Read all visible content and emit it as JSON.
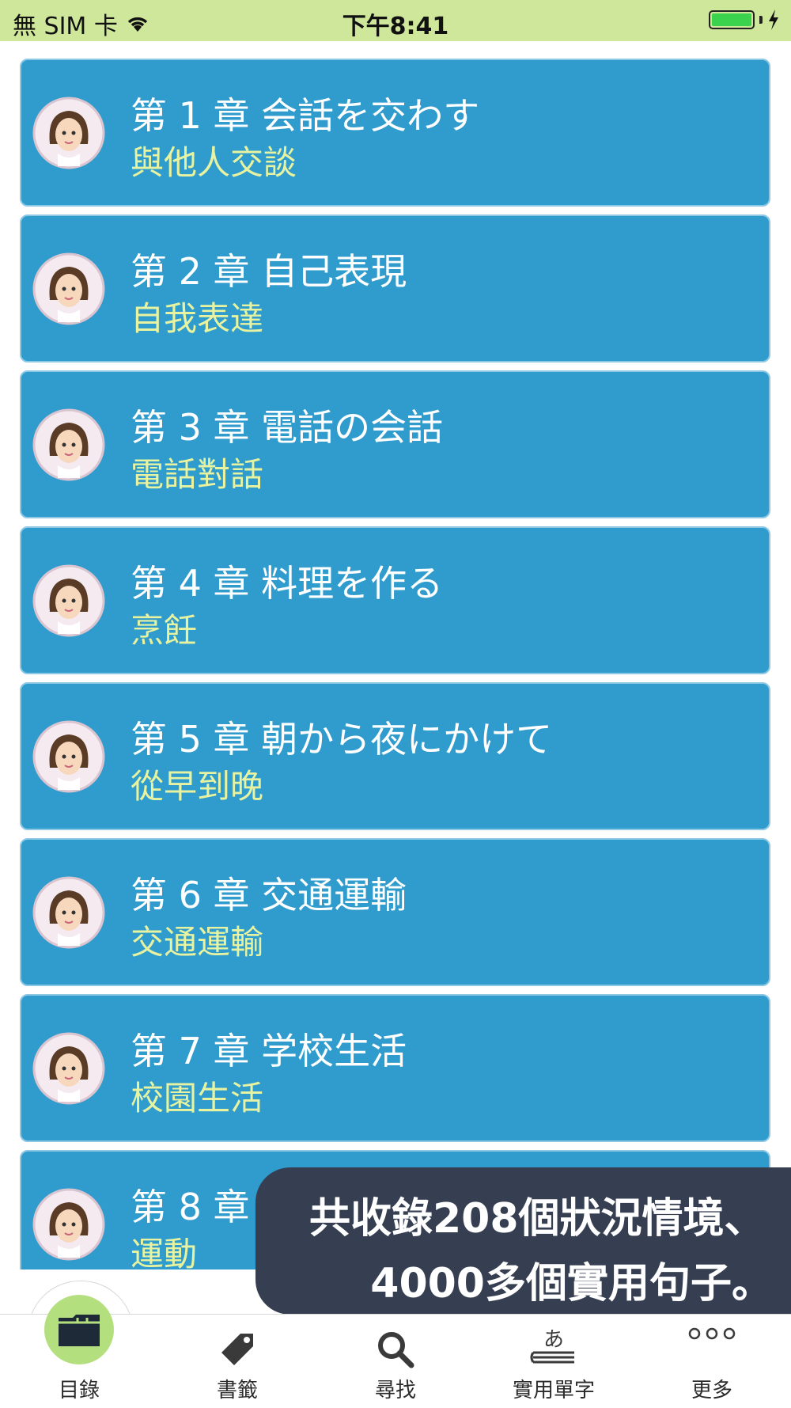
{
  "status_bar": {
    "carrier": "無 SIM 卡",
    "time": "下午8:41",
    "battery_level_percent": 100,
    "battery_color": "#3bd24e"
  },
  "chapters": [
    {
      "title": "第 1 章 会話を交わす",
      "subtitle": "與他人交談"
    },
    {
      "title": "第 2 章 自己表現",
      "subtitle": "自我表達"
    },
    {
      "title": "第 3 章 電話の会話",
      "subtitle": "電話對話"
    },
    {
      "title": "第 4 章 料理を作る",
      "subtitle": "烹飪"
    },
    {
      "title": "第 5 章 朝から夜にかけて",
      "subtitle": "從早到晚"
    },
    {
      "title": "第 6 章 交通運輸",
      "subtitle": "交通運輸"
    },
    {
      "title": "第 7 章 学校生活",
      "subtitle": "校園生活"
    },
    {
      "title": "第 8 章",
      "subtitle": "運動"
    }
  ],
  "toast": {
    "line1": "共收錄208個狀況情境、",
    "line2": "4000多個實用句子。"
  },
  "tabs": [
    {
      "label": "目錄",
      "icon": "folder-icon",
      "active": true
    },
    {
      "label": "書籤",
      "icon": "tag-icon",
      "active": false
    },
    {
      "label": "尋找",
      "icon": "search-icon",
      "active": false
    },
    {
      "label": "實用單字",
      "icon": "book-kana-icon",
      "active": false
    },
    {
      "label": "更多",
      "icon": "more-dots-icon",
      "active": false
    }
  ],
  "colors": {
    "status_bar_bg": "#cfe79a",
    "card_bg": "#2f9ccd",
    "card_subtitle": "#e7f3a0",
    "toast_bg": "#363f52",
    "active_tab_circle": "#b4df7e"
  }
}
